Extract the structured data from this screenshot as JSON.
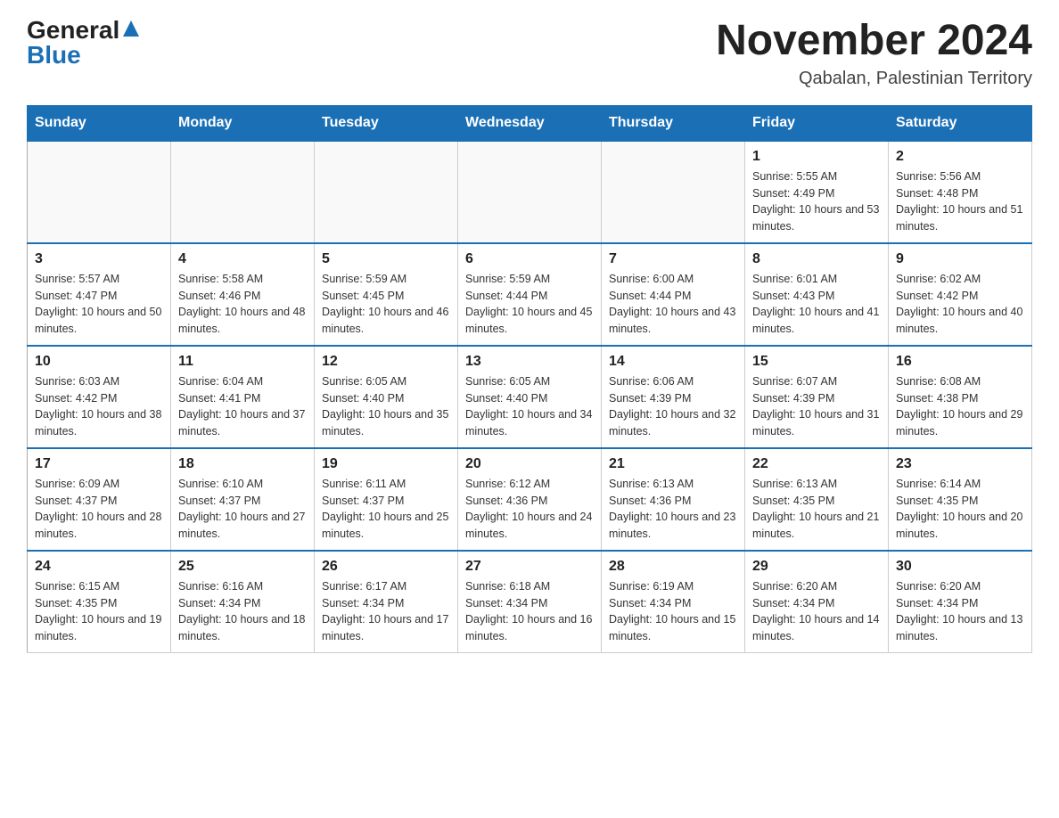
{
  "header": {
    "logo_general": "General",
    "logo_blue": "Blue",
    "title": "November 2024",
    "subtitle": "Qabalan, Palestinian Territory"
  },
  "days_of_week": [
    "Sunday",
    "Monday",
    "Tuesday",
    "Wednesday",
    "Thursday",
    "Friday",
    "Saturday"
  ],
  "weeks": [
    [
      {
        "day": "",
        "sunrise": "",
        "sunset": "",
        "daylight": ""
      },
      {
        "day": "",
        "sunrise": "",
        "sunset": "",
        "daylight": ""
      },
      {
        "day": "",
        "sunrise": "",
        "sunset": "",
        "daylight": ""
      },
      {
        "day": "",
        "sunrise": "",
        "sunset": "",
        "daylight": ""
      },
      {
        "day": "",
        "sunrise": "",
        "sunset": "",
        "daylight": ""
      },
      {
        "day": "1",
        "sunrise": "Sunrise: 5:55 AM",
        "sunset": "Sunset: 4:49 PM",
        "daylight": "Daylight: 10 hours and 53 minutes."
      },
      {
        "day": "2",
        "sunrise": "Sunrise: 5:56 AM",
        "sunset": "Sunset: 4:48 PM",
        "daylight": "Daylight: 10 hours and 51 minutes."
      }
    ],
    [
      {
        "day": "3",
        "sunrise": "Sunrise: 5:57 AM",
        "sunset": "Sunset: 4:47 PM",
        "daylight": "Daylight: 10 hours and 50 minutes."
      },
      {
        "day": "4",
        "sunrise": "Sunrise: 5:58 AM",
        "sunset": "Sunset: 4:46 PM",
        "daylight": "Daylight: 10 hours and 48 minutes."
      },
      {
        "day": "5",
        "sunrise": "Sunrise: 5:59 AM",
        "sunset": "Sunset: 4:45 PM",
        "daylight": "Daylight: 10 hours and 46 minutes."
      },
      {
        "day": "6",
        "sunrise": "Sunrise: 5:59 AM",
        "sunset": "Sunset: 4:44 PM",
        "daylight": "Daylight: 10 hours and 45 minutes."
      },
      {
        "day": "7",
        "sunrise": "Sunrise: 6:00 AM",
        "sunset": "Sunset: 4:44 PM",
        "daylight": "Daylight: 10 hours and 43 minutes."
      },
      {
        "day": "8",
        "sunrise": "Sunrise: 6:01 AM",
        "sunset": "Sunset: 4:43 PM",
        "daylight": "Daylight: 10 hours and 41 minutes."
      },
      {
        "day": "9",
        "sunrise": "Sunrise: 6:02 AM",
        "sunset": "Sunset: 4:42 PM",
        "daylight": "Daylight: 10 hours and 40 minutes."
      }
    ],
    [
      {
        "day": "10",
        "sunrise": "Sunrise: 6:03 AM",
        "sunset": "Sunset: 4:42 PM",
        "daylight": "Daylight: 10 hours and 38 minutes."
      },
      {
        "day": "11",
        "sunrise": "Sunrise: 6:04 AM",
        "sunset": "Sunset: 4:41 PM",
        "daylight": "Daylight: 10 hours and 37 minutes."
      },
      {
        "day": "12",
        "sunrise": "Sunrise: 6:05 AM",
        "sunset": "Sunset: 4:40 PM",
        "daylight": "Daylight: 10 hours and 35 minutes."
      },
      {
        "day": "13",
        "sunrise": "Sunrise: 6:05 AM",
        "sunset": "Sunset: 4:40 PM",
        "daylight": "Daylight: 10 hours and 34 minutes."
      },
      {
        "day": "14",
        "sunrise": "Sunrise: 6:06 AM",
        "sunset": "Sunset: 4:39 PM",
        "daylight": "Daylight: 10 hours and 32 minutes."
      },
      {
        "day": "15",
        "sunrise": "Sunrise: 6:07 AM",
        "sunset": "Sunset: 4:39 PM",
        "daylight": "Daylight: 10 hours and 31 minutes."
      },
      {
        "day": "16",
        "sunrise": "Sunrise: 6:08 AM",
        "sunset": "Sunset: 4:38 PM",
        "daylight": "Daylight: 10 hours and 29 minutes."
      }
    ],
    [
      {
        "day": "17",
        "sunrise": "Sunrise: 6:09 AM",
        "sunset": "Sunset: 4:37 PM",
        "daylight": "Daylight: 10 hours and 28 minutes."
      },
      {
        "day": "18",
        "sunrise": "Sunrise: 6:10 AM",
        "sunset": "Sunset: 4:37 PM",
        "daylight": "Daylight: 10 hours and 27 minutes."
      },
      {
        "day": "19",
        "sunrise": "Sunrise: 6:11 AM",
        "sunset": "Sunset: 4:37 PM",
        "daylight": "Daylight: 10 hours and 25 minutes."
      },
      {
        "day": "20",
        "sunrise": "Sunrise: 6:12 AM",
        "sunset": "Sunset: 4:36 PM",
        "daylight": "Daylight: 10 hours and 24 minutes."
      },
      {
        "day": "21",
        "sunrise": "Sunrise: 6:13 AM",
        "sunset": "Sunset: 4:36 PM",
        "daylight": "Daylight: 10 hours and 23 minutes."
      },
      {
        "day": "22",
        "sunrise": "Sunrise: 6:13 AM",
        "sunset": "Sunset: 4:35 PM",
        "daylight": "Daylight: 10 hours and 21 minutes."
      },
      {
        "day": "23",
        "sunrise": "Sunrise: 6:14 AM",
        "sunset": "Sunset: 4:35 PM",
        "daylight": "Daylight: 10 hours and 20 minutes."
      }
    ],
    [
      {
        "day": "24",
        "sunrise": "Sunrise: 6:15 AM",
        "sunset": "Sunset: 4:35 PM",
        "daylight": "Daylight: 10 hours and 19 minutes."
      },
      {
        "day": "25",
        "sunrise": "Sunrise: 6:16 AM",
        "sunset": "Sunset: 4:34 PM",
        "daylight": "Daylight: 10 hours and 18 minutes."
      },
      {
        "day": "26",
        "sunrise": "Sunrise: 6:17 AM",
        "sunset": "Sunset: 4:34 PM",
        "daylight": "Daylight: 10 hours and 17 minutes."
      },
      {
        "day": "27",
        "sunrise": "Sunrise: 6:18 AM",
        "sunset": "Sunset: 4:34 PM",
        "daylight": "Daylight: 10 hours and 16 minutes."
      },
      {
        "day": "28",
        "sunrise": "Sunrise: 6:19 AM",
        "sunset": "Sunset: 4:34 PM",
        "daylight": "Daylight: 10 hours and 15 minutes."
      },
      {
        "day": "29",
        "sunrise": "Sunrise: 6:20 AM",
        "sunset": "Sunset: 4:34 PM",
        "daylight": "Daylight: 10 hours and 14 minutes."
      },
      {
        "day": "30",
        "sunrise": "Sunrise: 6:20 AM",
        "sunset": "Sunset: 4:34 PM",
        "daylight": "Daylight: 10 hours and 13 minutes."
      }
    ]
  ]
}
